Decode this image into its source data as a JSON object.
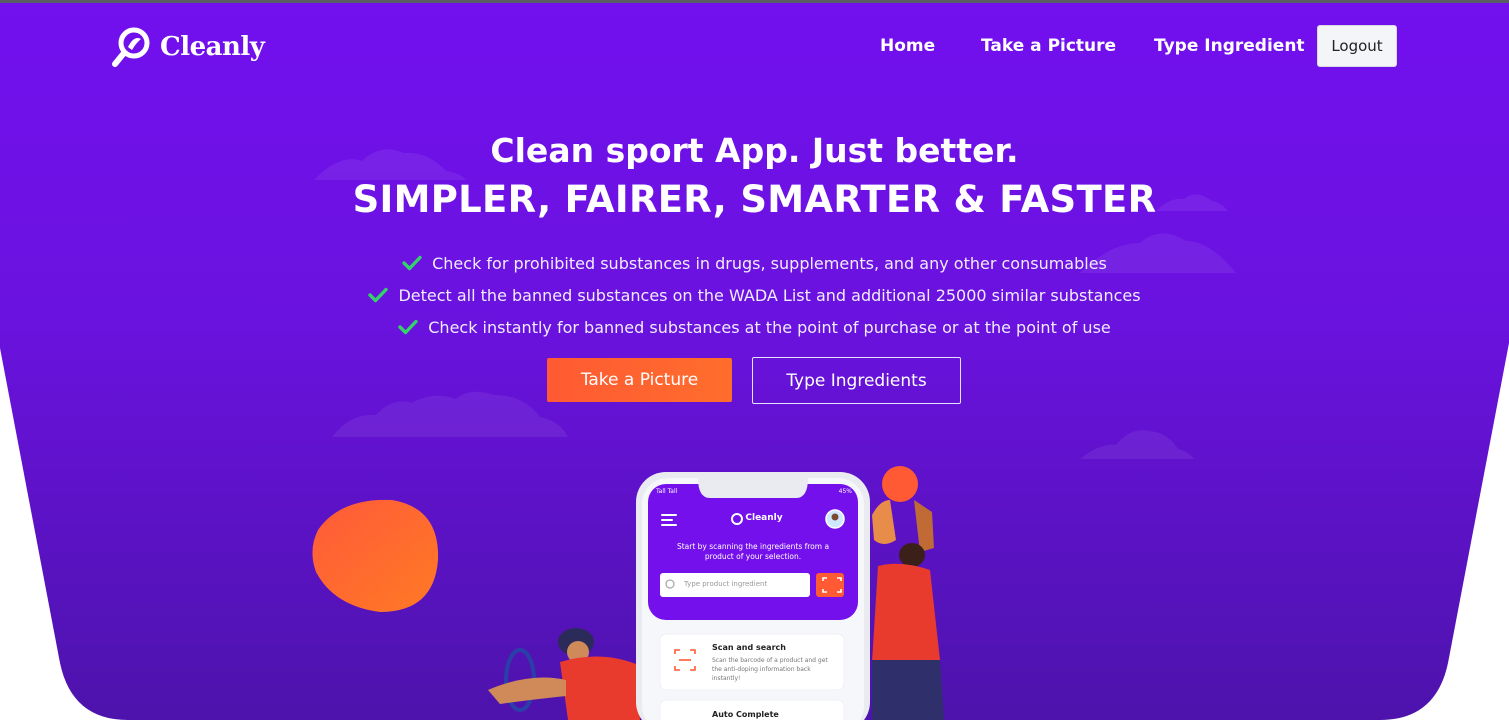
{
  "brand": {
    "name": "Cleanly"
  },
  "nav": {
    "items": [
      {
        "label": "Home"
      },
      {
        "label": "Take a Picture"
      },
      {
        "label": "Type Ingredient"
      }
    ],
    "logout_label": "Logout"
  },
  "hero": {
    "headline": "Clean sport App. Just better.",
    "subheadline": "SIMPLER, FAIRER, SMARTER & FASTER",
    "features": [
      "Check for prohibited substances in drugs, supplements, and any other consumables",
      "Detect all the banned substances on the WADA List and additional 25000 similar substances",
      "Check instantly for banned substances at the point of purchase or at the point of use"
    ],
    "primary_button": "Take a Picture",
    "secondary_button": "Type Ingredients"
  },
  "phone": {
    "status_left": "Tall Tall",
    "status_right": "45%",
    "app_name": "Cleanly",
    "intro": "Start by scanning the ingredients from a product of your selection.",
    "search_placeholder": "Type product ingredient",
    "card1_title": "Scan and search",
    "card1_text": "Scan the barcode of a product and get the anti-doping information back instantly!",
    "card2_title": "Auto Complete"
  },
  "colors": {
    "hero_top": "#7210ee",
    "hero_bottom": "#5312b8",
    "accent_orange": "#ff5a33",
    "check_green": "#33d26a"
  },
  "icons": [
    "cleanly-logo-icon",
    "check-icon",
    "menu-icon",
    "scan-icon",
    "search-icon",
    "avatar-icon"
  ]
}
